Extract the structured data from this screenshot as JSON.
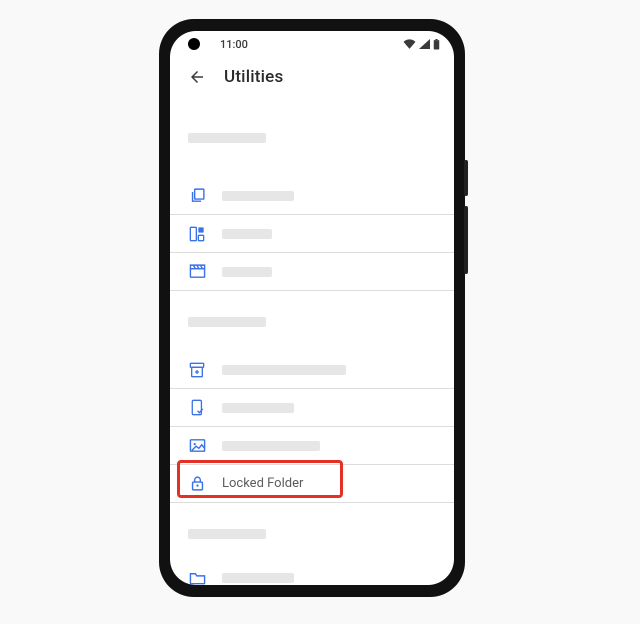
{
  "statusbar": {
    "time": "11:00"
  },
  "header": {
    "title": "Utilities"
  },
  "rows": {
    "locked_folder_label": "Locked Folder"
  },
  "icons": {
    "back": "arrow-left",
    "wifi": "wifi",
    "signal": "cell-signal",
    "battery": "battery",
    "copy": "copy-stack",
    "collage": "collage",
    "movie": "film-clapper",
    "archive_add": "archive-add",
    "phone_check": "phone-check",
    "image": "image",
    "lock": "lock",
    "folder": "folder"
  },
  "highlight": {
    "target": "locked-folder-row"
  }
}
